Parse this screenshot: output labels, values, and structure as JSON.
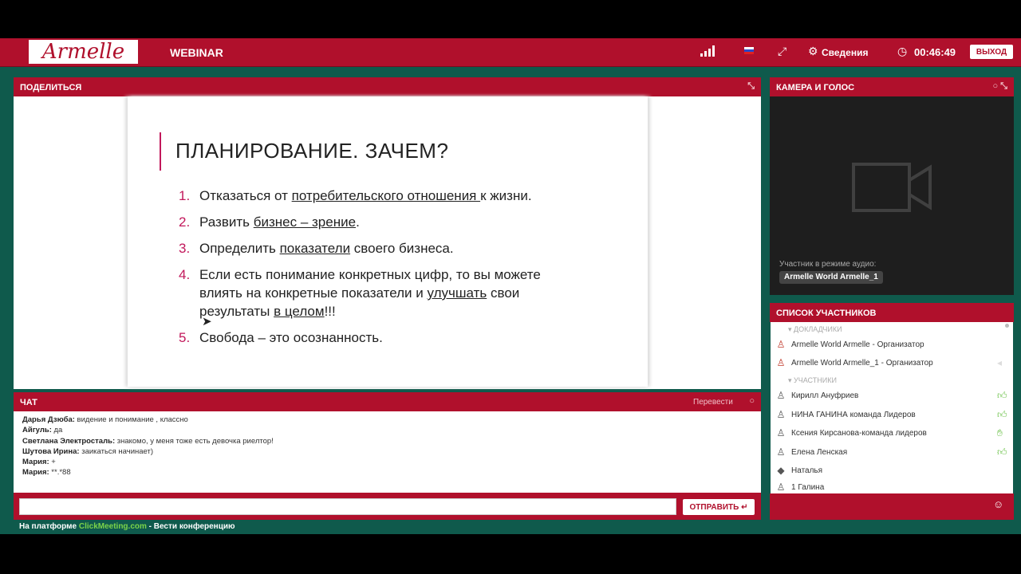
{
  "app": {
    "logo_text": "Armelle",
    "title": "WEBINAR",
    "info_label": "Сведения",
    "timer": "00:46:49",
    "exit_label": "ВЫХОД"
  },
  "share": {
    "header": "ПОДЕЛИТЬСЯ",
    "slide": {
      "title": "ПЛАНИРОВАНИЕ. ЗАЧЕМ?",
      "items": [
        {
          "num": "1.",
          "pre": "Отказаться от ",
          "u": "потребительского отношения ",
          "post": "к жизни."
        },
        {
          "num": "2.",
          "pre": "Развить ",
          "u": "бизнес – зрение",
          "post": "."
        },
        {
          "num": "3.",
          "pre": "Определить ",
          "u": "показатели",
          "post": " своего бизнеса."
        },
        {
          "num": "4.",
          "pre": "Если есть понимание конкретных цифр, то вы можете влиять на конкретные показатели и ",
          "u": "улучшать",
          "post": " свои результаты ",
          "u2": "в целом",
          "post2": "!!!"
        },
        {
          "num": "5.",
          "pre": "Свобода – это осознанность.",
          "u": "",
          "post": ""
        }
      ]
    }
  },
  "camera": {
    "header": "КАМЕРА И ГОЛОС",
    "audio_label": "Участник в режиме аудио:",
    "audio_participant": "Armelle World Armelle_1"
  },
  "participants": {
    "header": "СПИСОК УЧАСТНИКОВ",
    "group_speakers": "ДОКЛАДЧИКИ",
    "group_members": "УЧАСТНИКИ",
    "speakers": [
      "Armelle World Armelle - Организатор",
      "Armelle World Armelle_1 - Организатор"
    ],
    "members": [
      "Кирилл Ануфриев",
      "НИНА ГАНИНА команда Лидеров",
      "Ксения Кирсанова-команда лидеров",
      "Елена Ленская",
      "Наталья",
      "1 Галина"
    ]
  },
  "chat": {
    "header": "ЧАТ",
    "translate": "Перевести",
    "messages": [
      {
        "author": "Дарья Дзюба:",
        "text": " видение и понимание , классно"
      },
      {
        "author": "Айгуль:",
        "text": " да"
      },
      {
        "author": "Светлана Электросталь:",
        "text": " знакомо, у меня тоже есть девочка риелтор!"
      },
      {
        "author": "Шутова Ирина:",
        "text": " заикаться начинает)"
      },
      {
        "author": "Мария:",
        "text": " +"
      },
      {
        "author": "Мария:",
        "text": " **.*88"
      }
    ],
    "send_label": "ОТПРАВИТЬ ↵"
  },
  "footer": {
    "prefix": "На платформе ",
    "link": "ClickMeeting.com",
    "suffix": " - Вести конференцию"
  },
  "icons": [
    "signal-icon",
    "flag-ru-icon",
    "fullscreen-icon",
    "gear-icon",
    "clock-icon",
    "camera-icon",
    "person-icon",
    "thumb-up-icon",
    "smile-icon"
  ],
  "colors": {
    "brand": "#b0102c",
    "accent": "#c2185b",
    "link": "#7bd34a"
  }
}
